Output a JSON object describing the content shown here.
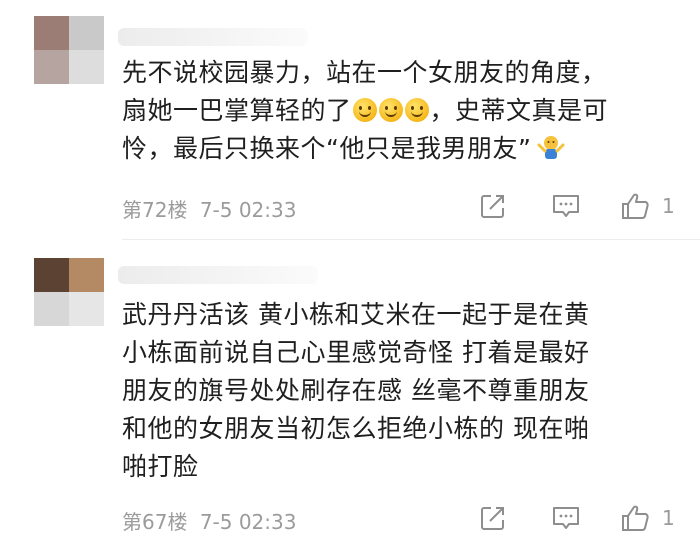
{
  "comments": [
    {
      "text_lines": [
        "先不说校园暴力，站在一个女朋友的角度，",
        "扇她一巴掌算轻的了",
        "，史蒂文真是可",
        "怜，最后只换来个“他只是我男朋友”"
      ],
      "floor": "第72楼",
      "date": "7-5 02:33",
      "like_count": "1",
      "emojis": [
        "slightly-smiling-face-icon",
        "slightly-smiling-face-icon",
        "slightly-smiling-face-icon"
      ],
      "trailing_emoji": "shrug-icon",
      "avatar_colors": [
        "#9b7d76",
        "#c9c9c9",
        "#b6a4a0",
        "#dddddd"
      ]
    },
    {
      "text_lines": [
        "武丹丹活该 黄小栋和艾米在一起于是在黄",
        "小栋面前说自己心里感觉奇怪 打着是最好",
        "朋友的旗号处处刷存在感 丝毫不尊重朋友",
        "和他的女朋友当初怎么拒绝小栋的 现在啪",
        "啪打脸"
      ],
      "floor": "第67楼",
      "date": "7-5 02:33",
      "like_count": "1",
      "avatar_colors": [
        "#5b4232",
        "#b38a63",
        "#d7d7d7",
        "#e6e6e6"
      ]
    }
  ]
}
